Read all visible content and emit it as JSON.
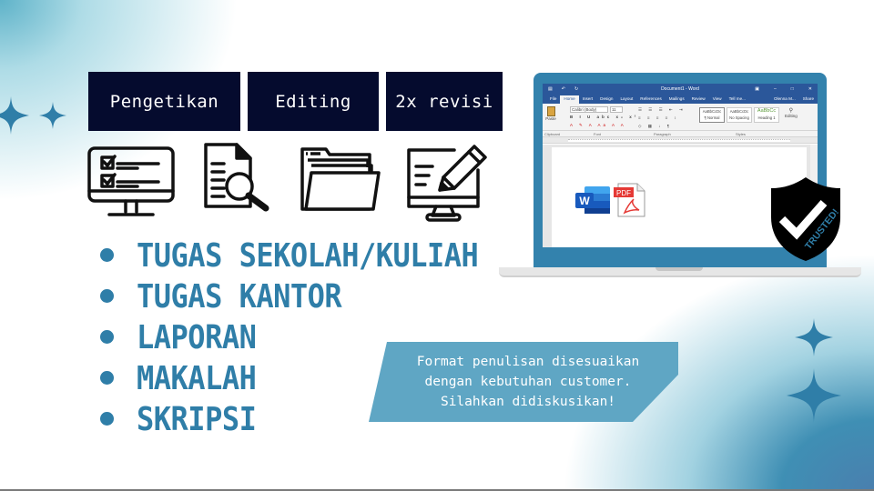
{
  "tags": [
    {
      "label": "Pengetikan"
    },
    {
      "label": "Editing"
    },
    {
      "label": "2x revisi"
    }
  ],
  "icons": [
    {
      "name": "monitor-checklist-icon"
    },
    {
      "name": "document-search-icon"
    },
    {
      "name": "open-folder-icon"
    },
    {
      "name": "monitor-edit-icon"
    }
  ],
  "services": [
    {
      "label": "TUGAS SEKOLAH/KULIAH"
    },
    {
      "label": "TUGAS KANTOR"
    },
    {
      "label": "LAPORAN"
    },
    {
      "label": "MAKALAH"
    },
    {
      "label": "SKRIPSI"
    }
  ],
  "note": {
    "lines": [
      "Format penulisan disesuaikan",
      "dengan kebutuhan customer.",
      "Silahkan didiskusikan!"
    ]
  },
  "word": {
    "window_title": "Document1 - Word",
    "tabs": [
      "File",
      "Home",
      "Insert",
      "Design",
      "Layout",
      "References",
      "Mailings",
      "Review",
      "View"
    ],
    "active_tab": "Home",
    "tell_me": "Tell me...",
    "user": "Olenna M...",
    "share": "Share",
    "font_name": "Calibri (Body)",
    "font_size": "11",
    "paste_label": "Paste",
    "editing_label": "Editing",
    "styles": [
      {
        "preview": "AaBbCcDc",
        "name": "¶ Normal"
      },
      {
        "preview": "AaBbCcDc",
        "name": "No Spacing"
      },
      {
        "preview": "AaBbCc",
        "name": "Heading 1"
      }
    ],
    "groups": [
      "Clipboard",
      "Font",
      "Paragraph",
      "Styles"
    ],
    "doc_icons": [
      {
        "name": "word-logo-icon",
        "label": "W"
      },
      {
        "name": "pdf-file-icon",
        "label": "PDF"
      }
    ]
  },
  "badge": {
    "label": "TRUSTED!"
  },
  "colors": {
    "tag_bg": "#050b2e",
    "accent": "#2f7ea8",
    "note_bg": "#5fa6c4",
    "word_blue": "#2b579a",
    "laptop_frame": "#3382ad"
  }
}
